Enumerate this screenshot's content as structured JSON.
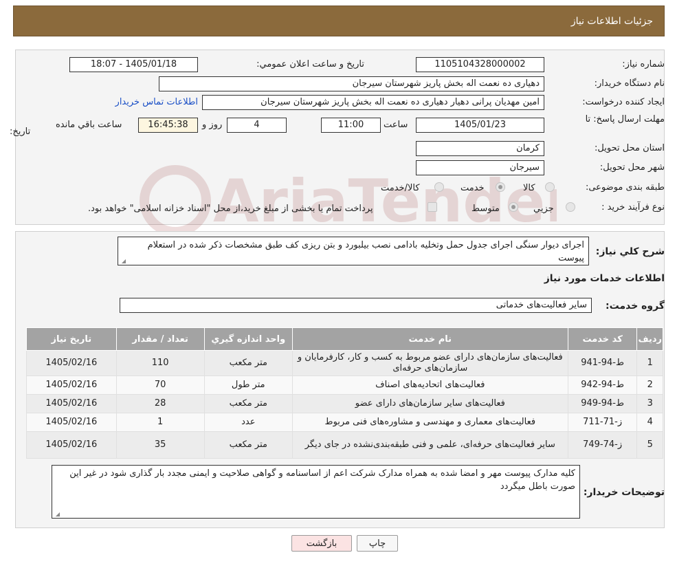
{
  "header": {
    "title": "جزئیات اطلاعات نیاز"
  },
  "form": {
    "need_number_label": "شماره نیاز:",
    "need_number": "1105104328000002",
    "announce_label": "تاریخ و ساعت اعلان عمومي:",
    "announce_value": "1405/01/18 - 18:07",
    "buyer_org_label": "نام دستگاه خريدار:",
    "buyer_org": "دهیاری ده نعمت اله بخش پاریز شهرستان سیرجان",
    "requester_label": "ايجاد كننده درخواست:",
    "requester": "امین مهدیان پرانی دهیار دهیاری ده نعمت اله بخش پاریز شهرستان سیرجان",
    "contact_link": "اطلاعات تماس خريدار",
    "deadline_label_1": "مهلت ارسال پاسخ: تا",
    "deadline_label_2": "تاریخ:",
    "deadline_date": "1405/01/23",
    "time_label": "ساعت",
    "deadline_time": "11:00",
    "days_value": "4",
    "days_label": "روز و",
    "remaining_time": "16:45:38",
    "remaining_label": "ساعت باقي مانده",
    "province_label": "استان محل تحويل:",
    "province": "کرمان",
    "city_label": "شهر محل تحويل:",
    "city": "سیرجان",
    "category_label": "طبقه بندی موضوعی:",
    "category_options": [
      "کالا",
      "خدمت",
      "کالا/خدمت"
    ],
    "category_selected": "خدمت",
    "purchase_type_label": "نوع فرآيند خريد :",
    "purchase_options": [
      "جزيي",
      "متوسط"
    ],
    "purchase_selected": "متوسط",
    "payment_note": "پرداخت تمام یا بخشی از مبلغ خرید،از محل \"اسناد خزانه اسلامی\" خواهد بود."
  },
  "general": {
    "summary_label": "شرح کلي نياز:",
    "summary": "اجرای دیوار سنگی اجرای جدول حمل وتخلیه بادامی نصب بیلبورد و بتن ریزی کف طبق مشخصات ذکر شده در استعلام پیوست",
    "services_title": "اطلاعات خدمات مورد نياز",
    "service_group_label": "گروه خدمت:",
    "service_group": "ساير فعاليت‌هاى خدماتى"
  },
  "table": {
    "headers": [
      "رديف",
      "کد خدمت",
      "نام خدمت",
      "واحد اندازه گيري",
      "تعداد / مقدار",
      "تاريخ نياز"
    ],
    "rows": [
      [
        "1",
        "ط-94-941",
        "فعالیت‌های سازمان‌های دارای عضو مربوط به کسب و کار، کارفرمایان و سازمان‌های حرفه‌ای",
        "متر مکعب",
        "110",
        "1405/02/16"
      ],
      [
        "2",
        "ط-94-942",
        "فعالیت‌های اتحادیه‌های اصناف",
        "متر طول",
        "70",
        "1405/02/16"
      ],
      [
        "3",
        "ط-94-949",
        "فعالیت‌های سایر سازمان‌های دارای عضو",
        "متر مکعب",
        "28",
        "1405/02/16"
      ],
      [
        "4",
        "ز-71-711",
        "فعالیت‌های معماری و مهندسی و مشاوره‌های فنی مربوط",
        "عدد",
        "1",
        "1405/02/16"
      ],
      [
        "5",
        "ز-74-749",
        "سایر فعالیت‌های حرفه‌ای، علمی و فنی طبقه‌بندی‌نشده در جای دیگر",
        "متر مکعب",
        "35",
        "1405/02/16"
      ]
    ]
  },
  "buyer_notes": {
    "label": "توضيحات خريدار:",
    "text": "کلیه مدارک پیوست مهر و امضا شده به همراه مدارک شرکت اعم از اساسنامه و گواهی صلاحیت و ایمنی مجدد بار گذاری شود در غیر این صورت باطل میگردد"
  },
  "buttons": {
    "print": "چاپ",
    "back": "بازگشت"
  },
  "watermark_text": "AriaTender.neT",
  "colors": {
    "header_bg": "#8b6a3c",
    "table_header_bg": "#a3a3a3",
    "link": "#1a4fc6",
    "back_btn_bg": "#fbe3e3"
  }
}
